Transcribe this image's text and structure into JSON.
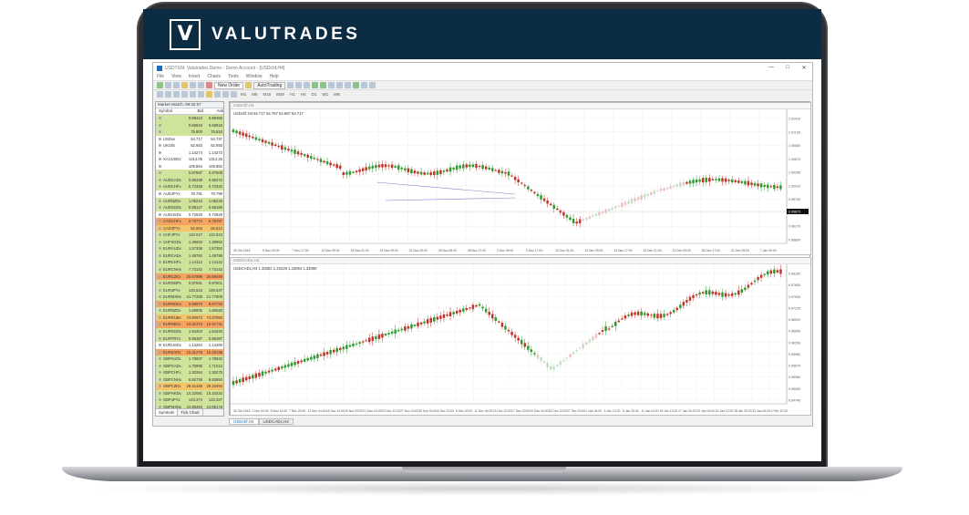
{
  "brand": {
    "logo_letter": "V",
    "name": "VALUTRADES"
  },
  "window": {
    "title": "USDTGN: Valutrades Demo - Demo Account - [USDchf,H4]",
    "controls": [
      "—",
      "□",
      "✕"
    ]
  },
  "menu": [
    "File",
    "View",
    "Insert",
    "Charts",
    "Tools",
    "Window",
    "Help"
  ],
  "toolbar": {
    "new_order": "New Order",
    "autotrading": "AutoTrading",
    "timeframes": [
      "M1",
      "M5",
      "M15",
      "M30",
      "H1",
      "H4",
      "D1",
      "W1",
      "MN"
    ]
  },
  "market_watch": {
    "header": "Market Watch: 09:32:57",
    "columns": [
      "Symbol",
      "Bid",
      "Ask"
    ],
    "rows": [
      {
        "s": "",
        "b": "0.89444",
        "a": "0.89466",
        "c": "#cfe39a"
      },
      {
        "s": "",
        "b": "0.69915",
        "a": "0.69918",
        "c": "#cfe39a"
      },
      {
        "s": "",
        "b": "75.800",
        "a": "75.810",
        "c": "#cfe39a"
      },
      {
        "s": "USDxx",
        "b": "54.717",
        "a": "54.737",
        "c": "#ffffff"
      },
      {
        "s": "UKOilx",
        "b": "62.663",
        "a": "62.693",
        "c": "#ffffff"
      },
      {
        "s": "",
        "b": "1.14274",
        "a": "1.14273",
        "c": "#ffffff"
      },
      {
        "s": "XAUUSDx",
        "b": "1314.05",
        "a": "1314.26",
        "c": "#ffffff"
      },
      {
        "s": "",
        "b": "109.864",
        "a": "109.882",
        "c": "#ffffff"
      },
      {
        "s": "",
        "b": "0.87587",
        "a": "0.87608",
        "c": "#cfe39a"
      },
      {
        "s": "AUDCADx",
        "b": "0.95339",
        "a": "0.95372",
        "c": "#cfe39a"
      },
      {
        "s": "AUDCHFx",
        "b": "0.72328",
        "a": "0.72332",
        "c": "#cfe39a"
      },
      {
        "s": "AUDJPYx",
        "b": "78.791",
        "a": "78.799",
        "c": "#ffffff"
      },
      {
        "s": "AUDNZDx",
        "b": "1.05215",
        "a": "1.05228",
        "c": "#cfe39a"
      },
      {
        "s": "AUDSGDx",
        "b": "0.98127",
        "a": "0.98159",
        "c": "#cfe39a"
      },
      {
        "s": "AUDUSDx",
        "b": "0.72625",
        "a": "0.72629",
        "c": "#ffffff"
      },
      {
        "s": "CADCHFx",
        "b": "0.75774",
        "a": "0.75787",
        "c": "#f6a261"
      },
      {
        "s": "CADJPYx",
        "b": "82.603",
        "a": "82.612",
        "c": "#f6c36a"
      },
      {
        "s": "CHFJPYx",
        "b": "110.017",
        "a": "110.023",
        "c": "#cfe39a"
      },
      {
        "s": "CHFSGDx",
        "b": "1.35934",
        "a": "1.35953",
        "c": "#cfe39a"
      },
      {
        "s": "EURAUDx",
        "b": "1.57336",
        "a": "1.57352",
        "c": "#cfe39a"
      },
      {
        "s": "EURCADx",
        "b": "1.49792",
        "a": "1.49798",
        "c": "#cfe39a"
      },
      {
        "s": "EURCHFx",
        "b": "1.14112",
        "a": "1.14122",
        "c": "#cfe39a"
      },
      {
        "s": "EURCNHx",
        "b": "7.73142",
        "a": "7.73142",
        "c": "#cfe39a"
      },
      {
        "s": "EURCZKx",
        "b": "25.67999",
        "a": "25.69049",
        "c": "#f6a261"
      },
      {
        "s": "EURGBPx",
        "b": "0.87591",
        "a": "0.87601",
        "c": "#cfe39a"
      },
      {
        "s": "EURJPYx",
        "b": "125.543",
        "a": "125.547",
        "c": "#cfe39a"
      },
      {
        "s": "EURMXNx",
        "b": "21.77208",
        "a": "21.77809",
        "c": "#cfe39a"
      },
      {
        "s": "EURNOKx",
        "b": "9.69973",
        "a": "9.67732",
        "c": "#f6a261"
      },
      {
        "s": "EURNZDx",
        "b": "1.65606",
        "a": "1.65620",
        "c": "#cfe39a"
      },
      {
        "s": "EURRUBx",
        "b": "74.60972",
        "a": "74.67992",
        "c": "#f6c36a"
      },
      {
        "s": "EURSEKx",
        "b": "10.41373",
        "a": "10.41741",
        "c": "#f6a261"
      },
      {
        "s": "EURSGDx",
        "b": "1.54403",
        "a": "1.54420",
        "c": "#cfe39a"
      },
      {
        "s": "EURTRYx",
        "b": "5.95387",
        "a": "5.95487",
        "c": "#cfe39a"
      },
      {
        "s": "EURUSDx",
        "b": "1.14264",
        "a": "1.14269",
        "c": "#ffffff"
      },
      {
        "s": "EURZARx",
        "b": "15.31278",
        "a": "15.32138",
        "c": "#f6a261"
      },
      {
        "s": "GBPAUDx",
        "b": "1.79607",
        "a": "1.79632",
        "c": "#cfe39a"
      },
      {
        "s": "GBPCADx",
        "b": "1.70995",
        "a": "1.71012",
        "c": "#cfe39a"
      },
      {
        "s": "GBPCHFx",
        "b": "1.30264",
        "a": "1.30275",
        "c": "#cfe39a"
      },
      {
        "s": "GBPCNHx",
        "b": "8.82738",
        "a": "8.82850",
        "c": "#cfe39a"
      },
      {
        "s": "GBPCZKx",
        "b": "29.31449",
        "a": "29.33494",
        "c": "#f6c36a"
      },
      {
        "s": "GBPHKDx",
        "b": "10.22081",
        "a": "10.23432",
        "c": "#cfe39a"
      },
      {
        "s": "GBPJPYx",
        "b": "143.374",
        "a": "143.327",
        "c": "#cfe39a"
      },
      {
        "s": "GBPMXNx",
        "b": "24.85453",
        "a": "24.85178",
        "c": "#cfe39a"
      }
    ],
    "tabs": [
      "Symbols",
      "Tick Chart"
    ]
  },
  "charts": {
    "top": {
      "window_title": "USDchf,H4",
      "info": "USDchf,H4  54.717 54.757 54.687 54.717",
      "price_labels": [
        "1.01410",
        "1.01130",
        "1.00850",
        "1.00570",
        "1.00290",
        "1.00010",
        "0.99730",
        "0.99450",
        "0.99170",
        "0.98890"
      ],
      "current_price": "0.99673",
      "time_labels": [
        "29 Oct 2018",
        "5 Nov 00:00",
        "7 Nov 17:00",
        "12 Nov 09:00",
        "15 Nov 01:00",
        "19 Nov 09:00",
        "22 Nov 00:00",
        "26 Nov 08:00",
        "28 Nov 17:00",
        "3 Dec 09:00",
        "5 Dec 17:00",
        "10 Dec 01:00",
        "12 Dec 09:00",
        "14 Dec 17:00",
        "19 Dec 01:00",
        "21 Dec 09:00",
        "26 Dec 17:00",
        "31 Dec 09:00",
        "7 Jan 09:00"
      ]
    },
    "bottom": {
      "window_title": "USDCADx,H4",
      "info": "USDCADx,H4  1.33082 1.33129 1.33064 1.33090",
      "price_labels": [
        "0.98150",
        "0.97840",
        "0.97530",
        "0.97220",
        "0.96910",
        "0.96600",
        "0.96290",
        "0.95980",
        "0.95670",
        "0.95360",
        "0.95050",
        "0.94740"
      ],
      "time_labels": [
        "26 Oct 2018",
        "1 Nov 04:00",
        "5 Nov 12:00",
        "7 Nov 20:00",
        "12 Nov 04:00",
        "14 Nov 12:00",
        "16 Nov 20:00",
        "21 Nov 04:00",
        "23 Nov 12:00",
        "27 Nov 20:00",
        "30 Nov 04:00",
        "4 Dec 12:00",
        "6 Dec 20:00",
        "11 Dec 04:00",
        "13 Dec 12:00",
        "17 Dec 20:00",
        "20 Dec 04:00",
        "24 Dec 12:00",
        "27 Dec 20:00",
        "1 Jan 04:00",
        "4 Jan 12:00",
        "8 Jan 20:00",
        "11 Jan 04:00",
        "15 Jan 12:00",
        "17 Jan 20:00",
        "22 Jan 04:00",
        "24 Jan 12:00",
        "28 Jan 20:00",
        "31 Jan 04:00",
        "4 Feb 12:00"
      ]
    },
    "tabs": [
      "USDchf,H4",
      "USDCADx,H4"
    ]
  },
  "colors": {
    "brand_bg": "#0c2c44",
    "bull": "#2e9b2e",
    "bear": "#c0342c"
  }
}
